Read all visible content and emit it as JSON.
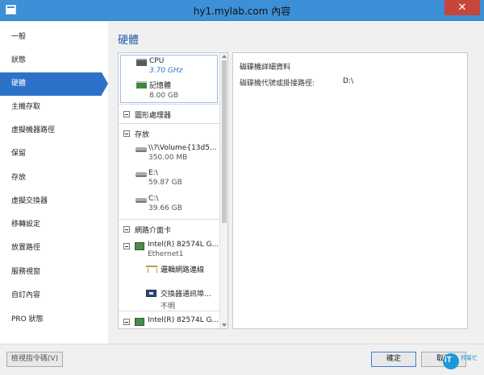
{
  "window": {
    "title": "hy1.mylab.com 內容",
    "close": "✕"
  },
  "sidebar": {
    "items": [
      {
        "label": "一般"
      },
      {
        "label": "狀態"
      },
      {
        "label": "硬體",
        "selected": true
      },
      {
        "label": "主機存取"
      },
      {
        "label": "虛擬機器路徑"
      },
      {
        "label": "保留"
      },
      {
        "label": "存放"
      },
      {
        "label": "虛擬交換器"
      },
      {
        "label": "移轉設定"
      },
      {
        "label": "放置路徑"
      },
      {
        "label": "服務視窗"
      },
      {
        "label": "自訂內容"
      },
      {
        "label": "PRO 狀態"
      }
    ]
  },
  "content": {
    "title": "硬體",
    "tree": {
      "cpu": {
        "label": "CPU",
        "value": "3.70 GHz"
      },
      "memory": {
        "label": "記憶體",
        "value": "8.00 GB"
      },
      "gpu_group": {
        "label": "圖形處理器"
      },
      "storage_group": {
        "label": "存放"
      },
      "disks": [
        {
          "label": "\\\\?\\Volume{13d5...",
          "value": "350.00 MB"
        },
        {
          "label": "E:\\",
          "value": "59.87 GB"
        },
        {
          "label": "C:\\",
          "value": "39.66 GB"
        }
      ],
      "nic_group": {
        "label": "網路介面卡"
      },
      "nic1": {
        "label": "Intel(R) 82574L G...",
        "value": "Ethernet1"
      },
      "logical_network": {
        "label": "邏輯網路連線"
      },
      "switch_port": {
        "label": "交換器通訊埠...",
        "value": "不明"
      },
      "nic2": {
        "label": "Intel(R) 82574L G..."
      }
    },
    "detail": {
      "title": "磁碟機詳細資料",
      "mount_label": "磁碟機代號或掛接路徑:",
      "mount_value": "D:\\"
    }
  },
  "footer": {
    "script_button": "檢視指令碼(V)",
    "ok_button": "確定",
    "cancel_button": "取消"
  },
  "watermark": {
    "logo": "iT",
    "text": "邦幫忙"
  }
}
